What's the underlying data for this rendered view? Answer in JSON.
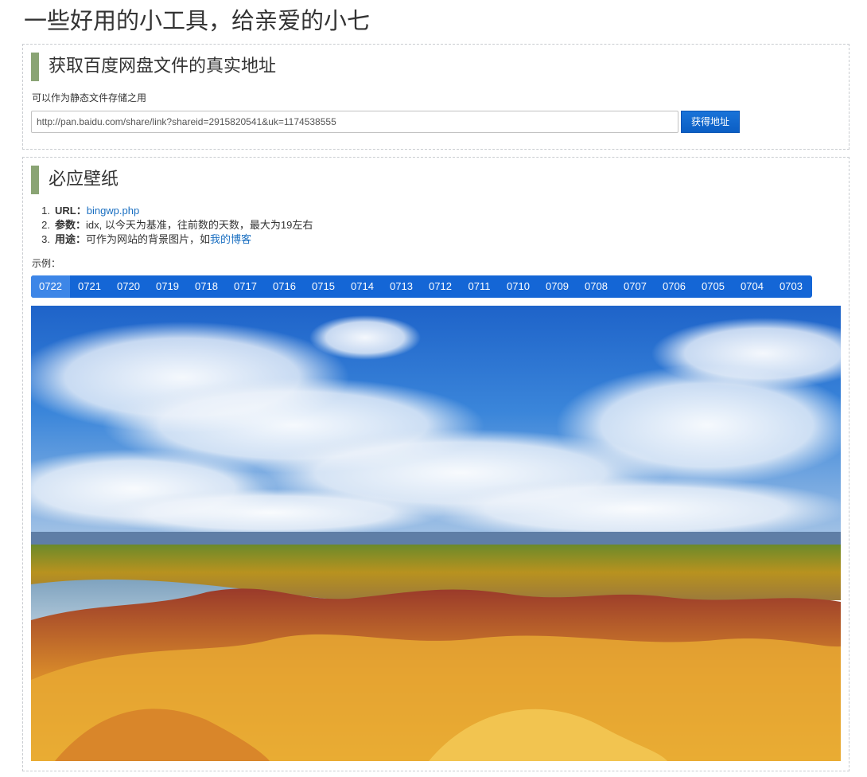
{
  "page": {
    "title": "一些好用的小工具，给亲爱的小七"
  },
  "baidu": {
    "title": "获取百度网盘文件的真实地址",
    "desc": "可以作为静态文件存储之用",
    "input_value": "http://pan.baidu.com/share/link?shareid=2915820541&uk=1174538555",
    "button_label": "获得地址"
  },
  "bing": {
    "title": "必应壁纸",
    "items": [
      {
        "num": "1.",
        "label": "URL：",
        "link": "bingwp.php"
      },
      {
        "num": "2.",
        "label": "参数：",
        "text": "idx, 以今天为基准，往前数的天数，最大为19左右"
      },
      {
        "num": "3.",
        "label": "用途：",
        "text": "可作为网站的背景图片，如",
        "link": "我的博客"
      }
    ],
    "example_label": "示例：",
    "dates": [
      "0722",
      "0721",
      "0720",
      "0719",
      "0718",
      "0717",
      "0716",
      "0715",
      "0714",
      "0713",
      "0712",
      "0711",
      "0710",
      "0709",
      "0708",
      "0707",
      "0706",
      "0705",
      "0704",
      "0703"
    ],
    "active_date": "0722"
  },
  "colors": {
    "accent_bar": "#8aa474",
    "button": "#0b5ec4",
    "date_bar": "#1466d6",
    "link": "#1a6fc1"
  }
}
